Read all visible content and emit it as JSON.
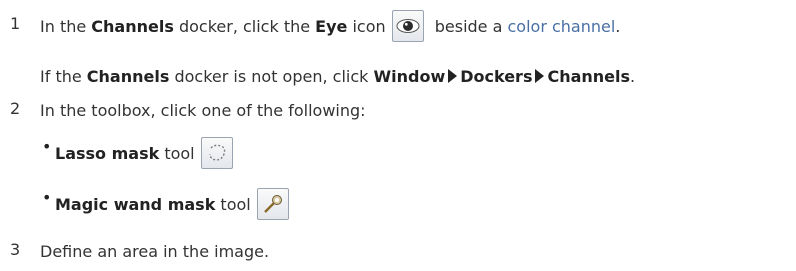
{
  "steps": [
    {
      "number": "1",
      "parts": {
        "t1": "In the ",
        "b1": "Channels",
        "t2": " docker, click the ",
        "b2": "Eye",
        "t3": " icon",
        "t4": " beside a ",
        "link": "color channel",
        "t5": "."
      },
      "note": {
        "t1": "If the ",
        "b1": "Channels",
        "t2": " docker is not open, click ",
        "m1": "Window",
        "m2": "Dockers",
        "m3": "Channels",
        "t3": "."
      }
    },
    {
      "number": "2",
      "text": "In the toolbox, click one of the following:",
      "options": [
        {
          "bold": "Lasso mask",
          "rest": " tool",
          "icon": "lasso-mask-tool-icon"
        },
        {
          "bold": "Magic wand mask",
          "rest": " tool",
          "icon": "magic-wand-mask-tool-icon"
        }
      ]
    },
    {
      "number": "3",
      "text": "Define an area in the image."
    }
  ],
  "icons": {
    "eye": "eye-icon",
    "menu_arrow": "triangle-right-icon"
  },
  "colors": {
    "text": "#333333",
    "link": "#4a6fa5"
  }
}
